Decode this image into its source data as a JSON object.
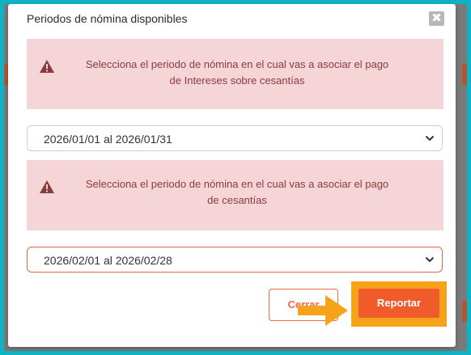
{
  "modal": {
    "title": "Periodos de nómina disponibles",
    "close_symbol": "✖"
  },
  "alerts": [
    {
      "icon": "warning-icon",
      "line1": "Selecciona el periodo de nómina en el cual vas a asociar el pago",
      "line2": "de Intereses sobre cesantías"
    },
    {
      "icon": "warning-icon",
      "line1": "Selecciona el periodo de nómina en el cual vas a asociar el pago",
      "line2": "de cesantías"
    }
  ],
  "selects": [
    {
      "value": "2026/01/01 al 2026/01/31"
    },
    {
      "value": "2026/02/01 al 2026/02/28"
    }
  ],
  "buttons": {
    "cancel_label": "Cerrar",
    "submit_label": "Reportar"
  },
  "colors": {
    "accent": "#f15a2b",
    "highlight_frame": "#f6a31b",
    "alert_bg": "#f5d5d8",
    "alert_text": "#8a3c3c",
    "screenshot_border": "#0fb3c6"
  }
}
